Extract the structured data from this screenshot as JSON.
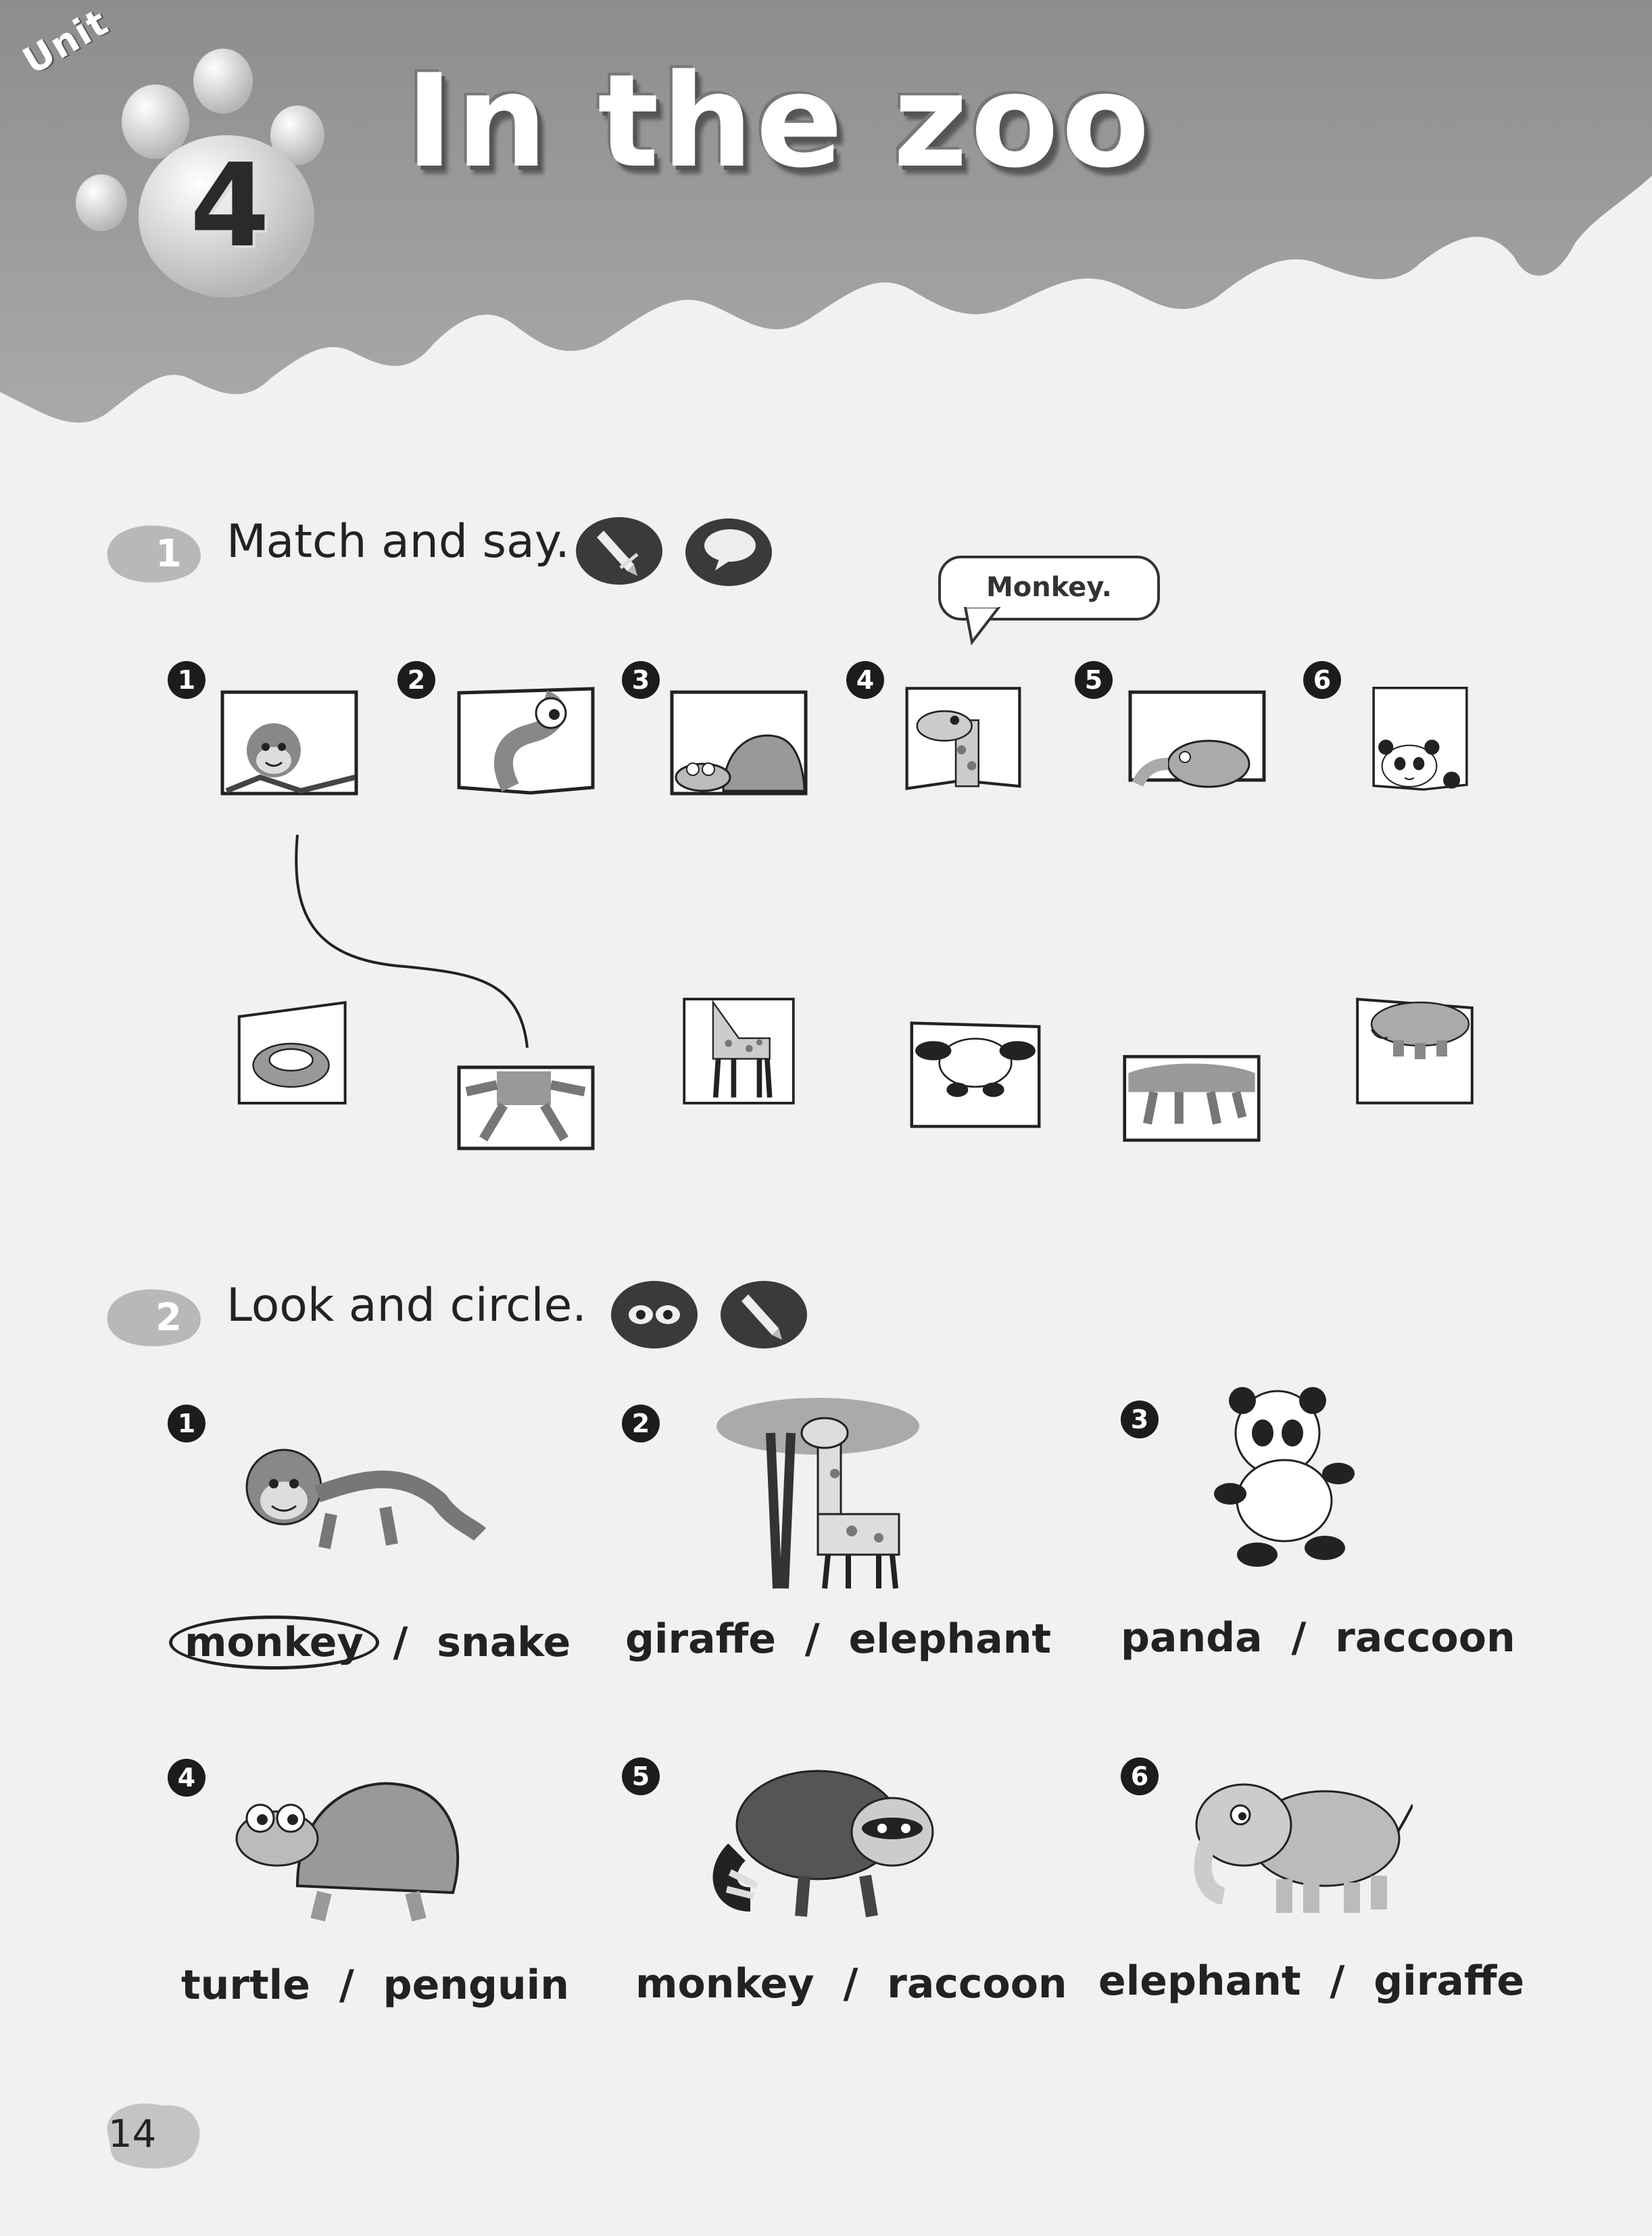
{
  "header": {
    "unit_label": "Unit",
    "unit_number": "4",
    "title": "In the zoo"
  },
  "exercise1": {
    "number": "1",
    "instruction": "Match and say.",
    "icons": [
      "pencil-icon",
      "speech-bubble-icon"
    ],
    "speech_bubble": "Monkey.",
    "top_numbers": [
      "1",
      "2",
      "3",
      "4",
      "5",
      "6"
    ],
    "top_cards": [
      "monkey head",
      "snake head",
      "turtle",
      "giraffe neck",
      "elephant head",
      "panda head"
    ],
    "bottom_cards": [
      "snake body",
      "monkey legs",
      "giraffe body",
      "panda body",
      "turtle legs",
      "elephant body"
    ]
  },
  "exercise2": {
    "number": "2",
    "instruction": "Look and circle.",
    "icons": [
      "eyes-icon",
      "pencil-icon"
    ],
    "items": [
      {
        "number": "1",
        "option_a": "monkey",
        "separator": "/",
        "option_b": "snake",
        "circled": "monkey"
      },
      {
        "number": "2",
        "option_a": "giraffe",
        "separator": "/",
        "option_b": "elephant"
      },
      {
        "number": "3",
        "option_a": "panda",
        "separator": "/",
        "option_b": "raccoon"
      },
      {
        "number": "4",
        "option_a": "turtle",
        "separator": "/",
        "option_b": "penguin"
      },
      {
        "number": "5",
        "option_a": "monkey",
        "separator": "/",
        "option_b": "raccoon"
      },
      {
        "number": "6",
        "option_a": "elephant",
        "separator": "/",
        "option_b": "giraffe"
      }
    ]
  },
  "footer": {
    "page_number": "14"
  }
}
